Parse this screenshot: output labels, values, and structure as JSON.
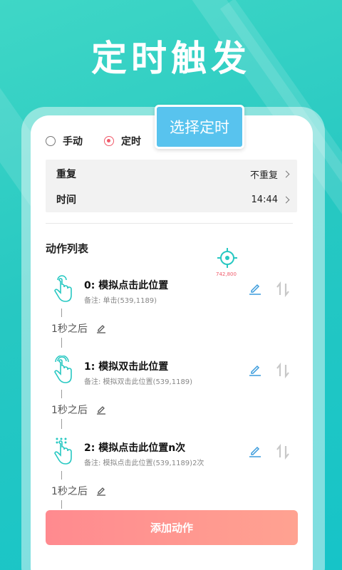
{
  "hero": {
    "title": "定时触发"
  },
  "tooltip": {
    "label": "选择定时"
  },
  "radios": [
    {
      "label": "手动",
      "selected": false
    },
    {
      "label": "定时",
      "selected": true
    }
  ],
  "settings": {
    "repeat_label": "重复",
    "repeat_value": "不重复",
    "time_label": "时间",
    "time_value": "14:44"
  },
  "actions_header": "动作列表",
  "target_coords": "742,800",
  "actions": [
    {
      "title": "0: 模拟点击此位置",
      "note": "备注:  单击(539,1189)",
      "icon": "tap-hand-icon"
    },
    {
      "title": "1: 模拟双击此位置",
      "note": "备注:  模拟双击此位置(539,1189)",
      "icon": "double-tap-hand-icon"
    },
    {
      "title": "2: 模拟点击此位置n次",
      "note": "备注:  模拟点击此位置(539,1189)2次",
      "icon": "multi-tap-hand-icon"
    }
  ],
  "delays": [
    "1秒之后",
    "1秒之后",
    "1秒之后"
  ],
  "add_button": "添加动作",
  "colors": {
    "accent_teal": "#27c8c2",
    "accent_blue": "#58c3ee",
    "accent_red": "#f05a6a"
  }
}
